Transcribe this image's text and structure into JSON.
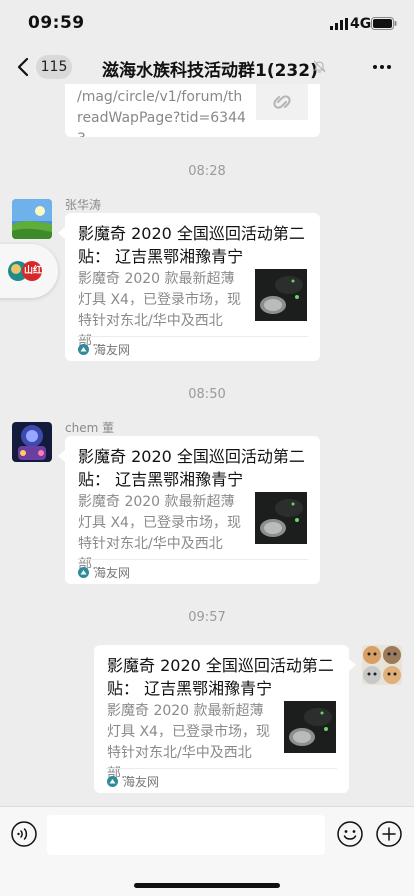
{
  "status_bar": {
    "time": "09:59",
    "network": "4G"
  },
  "nav": {
    "unread_count": "115",
    "title": "滋海水族科技活动群1(232)"
  },
  "link_message": {
    "url_text": "/mag/circle/v1/forum/threadWapPage?tid=63443..."
  },
  "timestamps": [
    "08:28",
    "08:50",
    "09:57"
  ],
  "messages": [
    {
      "sender": "张华涛",
      "title": "影魔奇 2020 全国巡回活动第二贴： 辽吉黑鄂湘豫青宁",
      "desc": "影魔奇 2020 款最新超薄灯具 X4，已登录市场，现特针对东北/华中及西北部...",
      "source": "海友网"
    },
    {
      "sender": "chem 董",
      "title": "影魔奇 2020 全国巡回活动第二贴： 辽吉黑鄂湘豫青宁",
      "desc": "影魔奇 2020 款最新超薄灯具 X4，已登录市场，现特针对东北/华中及西北部...",
      "source": "海友网"
    },
    {
      "sender": "",
      "title": "影魔奇 2020 全国巡回活动第二贴： 辽吉黑鄂湘豫青宁",
      "desc": "影魔奇 2020 款最新超薄灯具 X4，已登录市场，现特针对东北/华中及西北部...",
      "source": "海友网"
    }
  ],
  "floating_widget": {
    "badge_text": "山红"
  },
  "colors": {
    "background": "#ededed",
    "bubble": "#ffffff",
    "source_icon": "#2e8b9a"
  }
}
